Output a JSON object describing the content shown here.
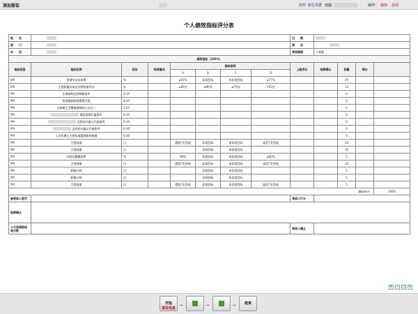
{
  "topbar": {
    "title": "添加报告",
    "print": "打印",
    "new_process": "新生单据",
    "create": "创建:",
    "action_label": "操作:",
    "save": "保存",
    "close": "关闭"
  },
  "doc_title": "个人绩效指标评分表",
  "info": {
    "name_label": "姓　　名",
    "date_label": "日　　期",
    "dept_label": "部　　门",
    "position_label": "岗　　位",
    "year_label": "年　　份",
    "period_label": "考核周期",
    "period_value": "二季度"
  },
  "section_title": "绩效指标（100%）",
  "columns": {
    "type": "指标类型",
    "name": "指标名称",
    "target": "目标",
    "actual": "完成情况",
    "desc": "指标说明",
    "a": "A",
    "b": "B",
    "c": "C",
    "d": "D",
    "leader_score": "上级评分",
    "result_confirm": "结果确认",
    "weight": "权重",
    "score": "得分"
  },
  "rows": [
    {
      "type": "KPI",
      "name": "关键节点达成率",
      "target": "%",
      "a": "≥97%",
      "b": "实现目标",
      "c": "未实现目标",
      "d": "≤77%",
      "weight": "25"
    },
    {
      "type": "KPI",
      "name": "工程质量及安全文明检查评分",
      "target": "分",
      "a": "≥85分",
      "b": "≥80分",
      "c": "≥75分",
      "d": "<65分",
      "weight": "15"
    },
    {
      "type": "PPI",
      "name": "主体结构达到销售条件",
      "target": "4-15",
      "a": "",
      "b": "",
      "c": "",
      "d": "",
      "weight": "0"
    },
    {
      "type": "PPI",
      "name": "完成基础有桩围墙工程",
      "target": "4-15",
      "a": "",
      "b": "",
      "c": "",
      "d": "",
      "weight": "0"
    },
    {
      "type": "PPI",
      "name": "主体施工至整体结构的二分之一",
      "target": "5-25",
      "a": "",
      "b": "",
      "c": "",
      "d": "",
      "weight": "0"
    },
    {
      "type": "PPI",
      "name": "满足首期开盘条件",
      "target": "6-10",
      "a": "",
      "b": "",
      "c": "",
      "d": "",
      "weight": "0"
    },
    {
      "type": "PPI",
      "name": "达到对外展示开放条件",
      "target": "6-30",
      "a": "",
      "b": "",
      "c": "",
      "d": "",
      "weight": "0"
    },
    {
      "type": "PPI",
      "name": "达到对外展示开放条件",
      "target": "6-30",
      "a": "",
      "b": "",
      "c": "",
      "d": "",
      "weight": "0"
    },
    {
      "type": "PPI",
      "name": "上半年建立工程标准管理体系制度",
      "target": "6-30",
      "a": "",
      "b": "",
      "c": "",
      "d": "",
      "weight": "0"
    },
    {
      "type": "PPI",
      "name": "工程进度",
      "target": "日",
      "a": "提前7天完成",
      "b": "实现目标",
      "c": "未实现目标",
      "d": "延迟7天完成",
      "weight": "10"
    },
    {
      "type": "PPI",
      "name": "工程进度",
      "target": "日",
      "a": "",
      "b": "实现目标",
      "c": "未实现目标",
      "d": "",
      "weight": "10"
    },
    {
      "type": "PPI",
      "name": "内检问题整改率",
      "target": "%",
      "a": "90%",
      "b": "实现目标",
      "c": "未实现目标",
      "d": "≤80%",
      "weight": "5"
    },
    {
      "type": "PPI",
      "name": "工程进度",
      "target": "日",
      "a": "提前7天完成",
      "b": "实现目标",
      "c": "未实现目标",
      "d": "延迟7天完成",
      "weight": "10"
    },
    {
      "type": "PPI",
      "name": "职能计划",
      "target": "日",
      "a": "",
      "b": "实现目标",
      "c": "未实现目标",
      "d": "",
      "weight": "5"
    },
    {
      "type": "PPI",
      "name": "职能计划",
      "target": "日",
      "a": "",
      "b": "实现目标",
      "c": "未实现目标",
      "d": "",
      "weight": "5"
    },
    {
      "type": "PPI",
      "name": "工程进度",
      "target": "日",
      "a": "提前7天完成",
      "b": "实现目标",
      "c": "未实现目标",
      "d": "延迟7天完成",
      "weight": "5"
    }
  ],
  "total_label": "指标合计：",
  "total_value": "100%",
  "footer": {
    "self_sign": "被考核人签字",
    "assessor_score": "考核人打分",
    "result_confirm": "结果确认",
    "hr_review": "人力资源部核准分数",
    "assessor_confirm": "考核人确认"
  },
  "flow": {
    "start_label": "开始",
    "start_sub": "填写信息",
    "end_label": "结束"
  }
}
